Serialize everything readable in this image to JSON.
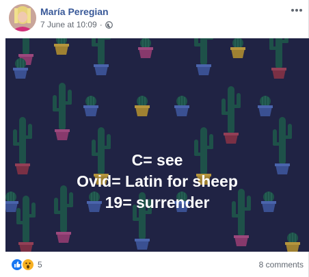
{
  "post": {
    "author": "María Peregian",
    "date": "7 June at 10:09",
    "privacy_icon": "globe-icon",
    "options_icon": "more-options-icon"
  },
  "image": {
    "background_color": "#202344",
    "pattern": "cactus-pattern",
    "lines": [
      "C= see",
      "Ovid= Latin for sheep",
      "19= surrender"
    ]
  },
  "footer": {
    "reaction_icons": [
      "like-reaction-icon",
      "wow-reaction-icon"
    ],
    "reaction_count": "5",
    "comments": "8 comments"
  },
  "colors": {
    "link": "#385898",
    "meta": "#616770",
    "like_blue": "#1877f2",
    "wow_yellow": "#f7b125"
  }
}
